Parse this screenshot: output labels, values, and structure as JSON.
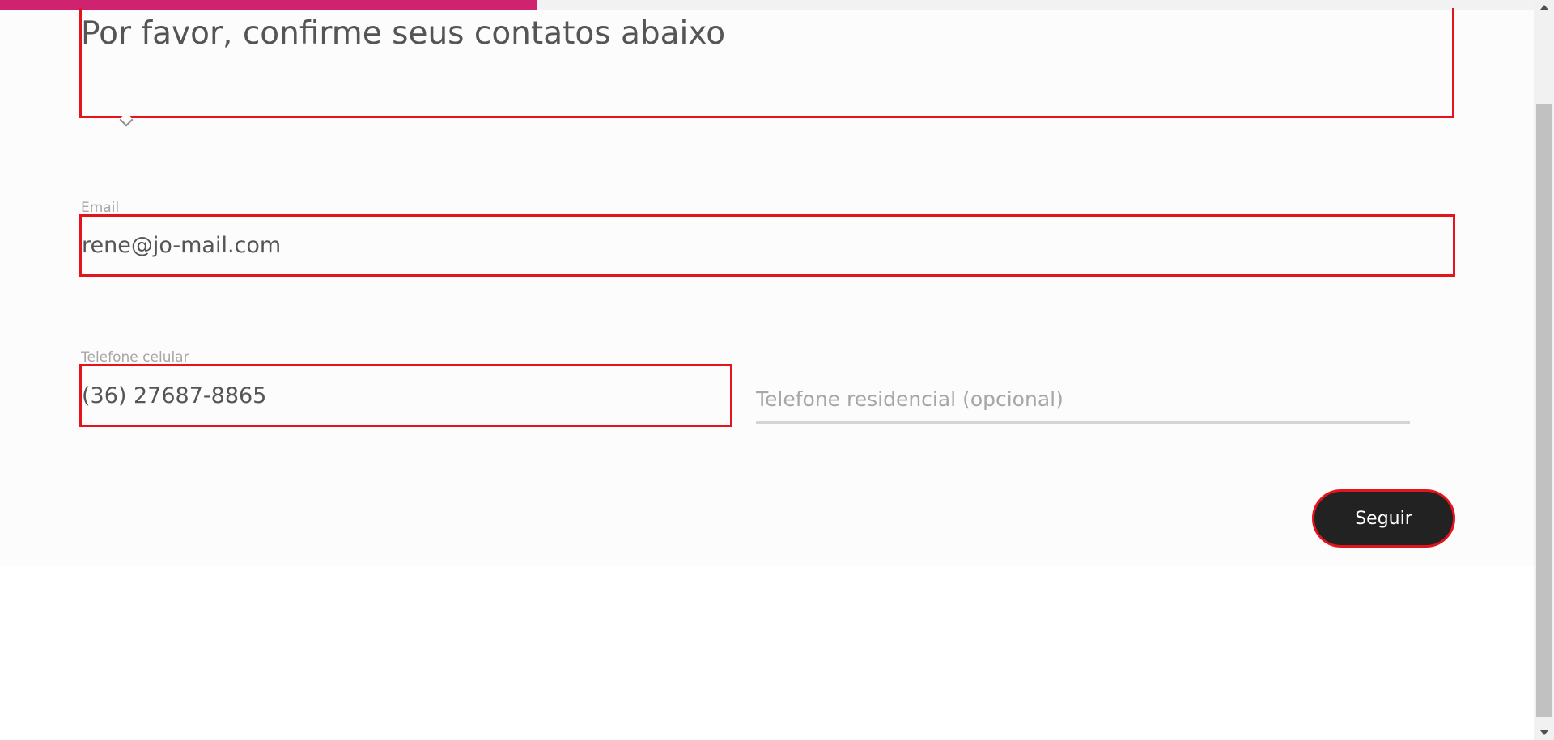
{
  "progress": {
    "fraction": 0.35,
    "color": "#cf2370"
  },
  "form": {
    "title": "Por favor, confirme seus contatos abaixo",
    "email": {
      "label": "Email",
      "value": "rene@jo-mail.com"
    },
    "mobile_phone": {
      "label": "Telefone celular",
      "value": "(36) 27687-8865"
    },
    "home_phone": {
      "placeholder": "Telefone residencial (opcional)",
      "value": ""
    },
    "submit_label": "Seguir"
  },
  "colors": {
    "highlight_border": "#e3141c",
    "button_bg": "#222222",
    "text": "#555555",
    "label": "#a6a6a6"
  },
  "icons": {
    "dropdown": "chevron-down-icon",
    "scroll_up": "arrow-up-icon",
    "scroll_down": "arrow-down-icon"
  }
}
